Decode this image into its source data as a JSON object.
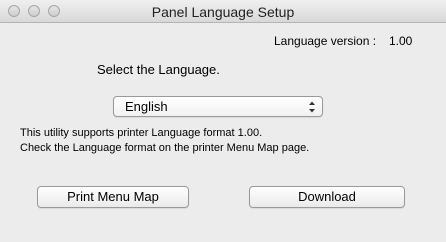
{
  "window": {
    "title": "Panel Language Setup"
  },
  "version": {
    "label": "Language version :",
    "value": "1.00"
  },
  "language": {
    "heading": "Select the Language.",
    "selected": "English"
  },
  "info": {
    "line1": "This utility supports printer Language format 1.00.",
    "line2": "Check the Language format on the printer Menu Map page."
  },
  "buttons": {
    "print_menu_map": "Print Menu Map",
    "download": "Download"
  }
}
